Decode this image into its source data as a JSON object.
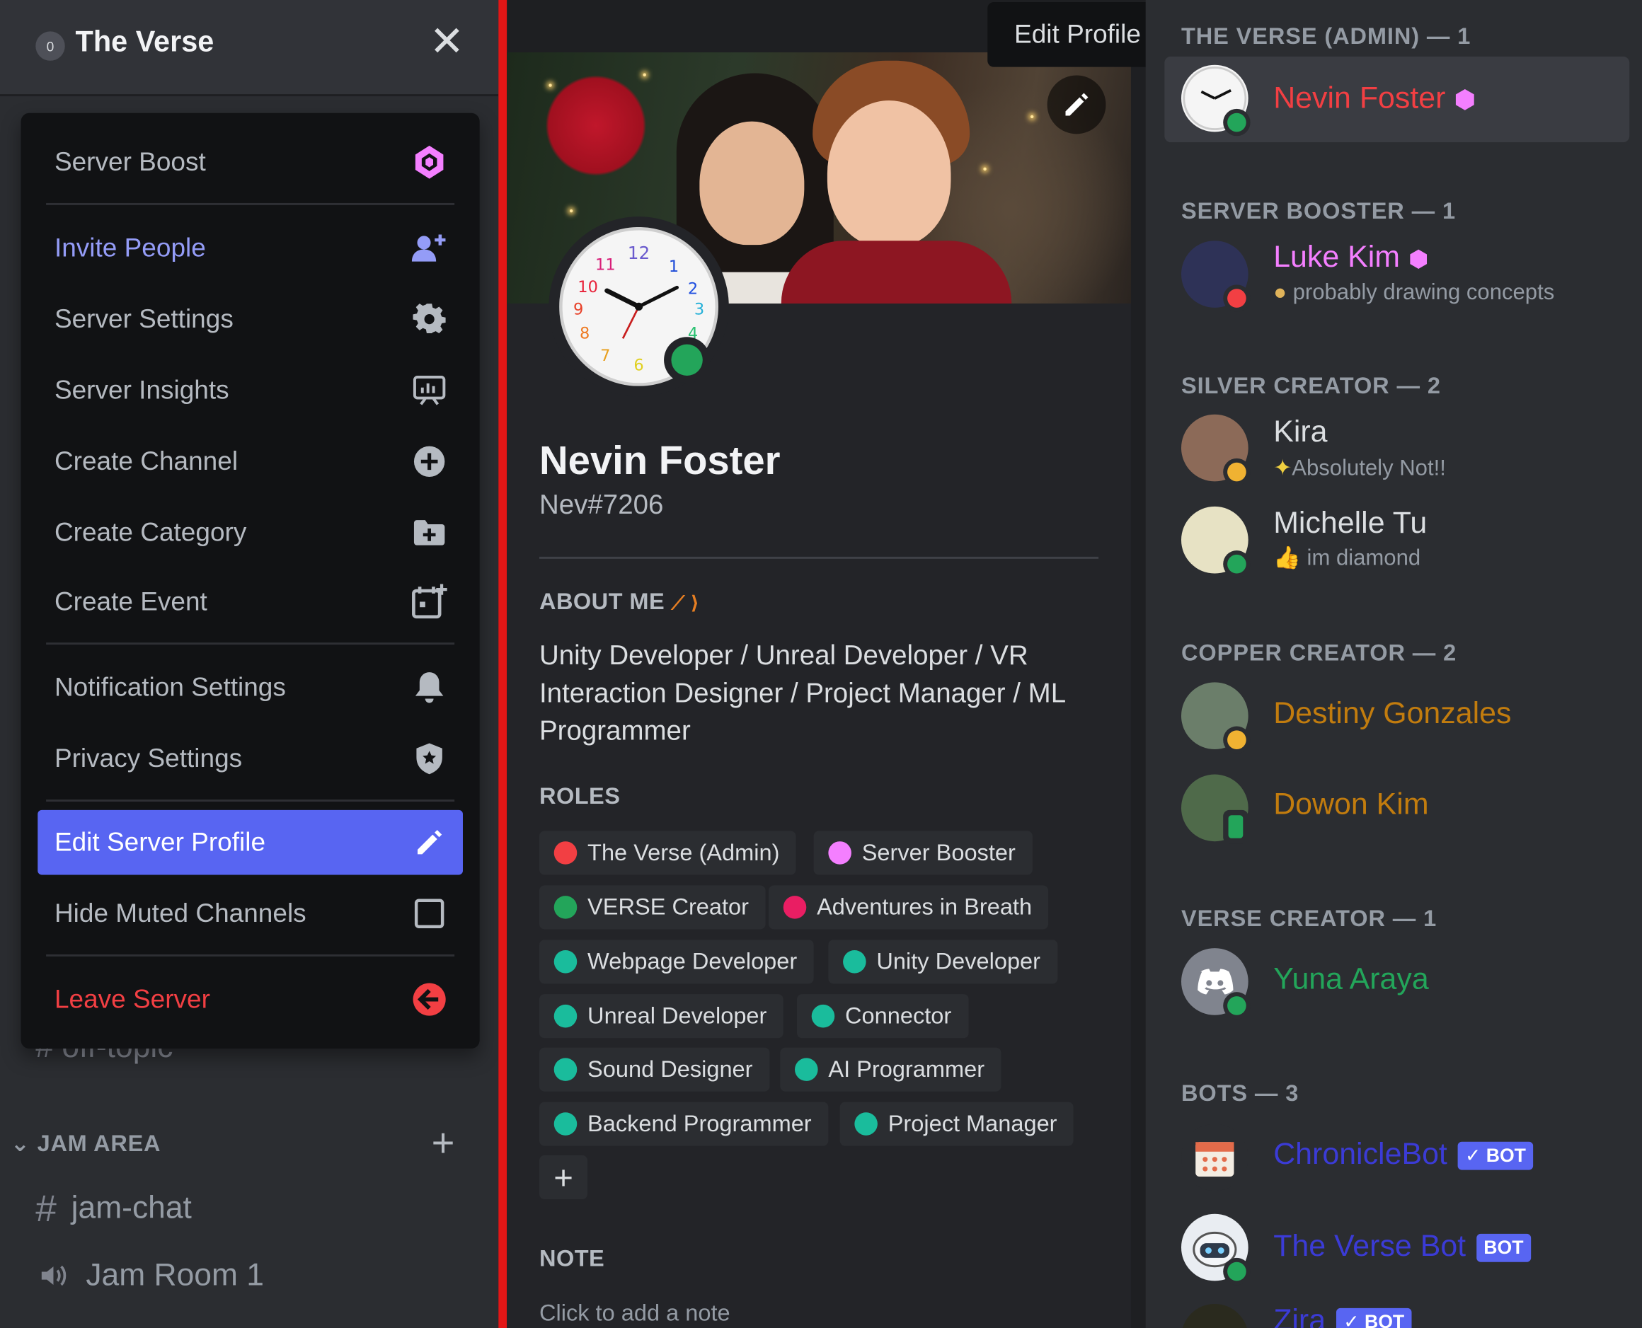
{
  "server": {
    "name": "The Verse",
    "close_glyph": "✕"
  },
  "menu": {
    "items": [
      {
        "label": "Server Boost",
        "icon": "boost-gem-icon"
      },
      {
        "label": "Invite People",
        "icon": "invite-person-icon"
      },
      {
        "label": "Server Settings",
        "icon": "gear-icon"
      },
      {
        "label": "Server Insights",
        "icon": "insights-chart-icon"
      },
      {
        "label": "Create Channel",
        "icon": "plus-circle-icon"
      },
      {
        "label": "Create Category",
        "icon": "folder-plus-icon"
      },
      {
        "label": "Create Event",
        "icon": "calendar-plus-icon"
      },
      {
        "label": "Notification Settings",
        "icon": "bell-icon"
      },
      {
        "label": "Privacy Settings",
        "icon": "shield-icon"
      },
      {
        "label": "Edit Server Profile",
        "icon": "pencil-icon"
      },
      {
        "label": "Hide Muted Channels",
        "icon": "checkbox-icon"
      },
      {
        "label": "Leave Server",
        "icon": "leave-arrow-icon"
      }
    ]
  },
  "channels_behind": {
    "off_topic": "off-topic",
    "category": "JAM AREA",
    "text_channel": "jam-chat",
    "voice_channel": "Jam Room 1"
  },
  "tooltip": "Edit Profile",
  "profile": {
    "display_name": "Nevin Foster",
    "tag": "Nev#7206",
    "about_header": "ABOUT ME",
    "about": "Unity Developer / Unreal Developer / VR Interaction Designer / Project Manager / ML Programmer",
    "roles_header": "ROLES",
    "roles": [
      {
        "name": "The Verse (Admin)",
        "color": "#f23f43"
      },
      {
        "name": "Server Booster",
        "color": "#f47fff"
      },
      {
        "name": "VERSE Creator",
        "color": "#23a55a"
      },
      {
        "name": "Adventures in Breath",
        "color": "#e91e63"
      },
      {
        "name": "Webpage Developer",
        "color": "#1abc9c"
      },
      {
        "name": "Unity Developer",
        "color": "#1abc9c"
      },
      {
        "name": "Unreal Developer",
        "color": "#1abc9c"
      },
      {
        "name": "Connector",
        "color": "#1abc9c"
      },
      {
        "name": "Sound Designer",
        "color": "#1abc9c"
      },
      {
        "name": "AI Programmer",
        "color": "#1abc9c"
      },
      {
        "name": "Backend Programmer",
        "color": "#1abc9c"
      },
      {
        "name": "Project Manager",
        "color": "#1abc9c"
      }
    ],
    "add_role_glyph": "+",
    "note_header": "NOTE",
    "note_placeholder": "Click to add a note",
    "status_color": "#23a55a"
  },
  "member_groups": [
    {
      "label": "THE VERSE (ADMIN) — 1"
    },
    {
      "label": "SERVER BOOSTER — 1"
    },
    {
      "label": "SILVER CREATOR — 2"
    },
    {
      "label": "COPPER CREATOR — 2"
    },
    {
      "label": "VERSE CREATOR — 1"
    },
    {
      "label": "BOTS — 3"
    }
  ],
  "members": [
    {
      "name": "Nevin Foster",
      "color": "#f23f43",
      "activity": "",
      "status": "online"
    },
    {
      "name": "Luke Kim",
      "color": "#f47fff",
      "activity": "probably drawing concepts",
      "status": "dnd"
    },
    {
      "name": "Kira",
      "color": "#dbdee1",
      "activity": "Absolutely Not!!",
      "status": "idle"
    },
    {
      "name": "Michelle Tu",
      "color": "#dbdee1",
      "activity": "im diamond",
      "status": "online"
    },
    {
      "name": "Destiny Gonzales",
      "color": "#c27c0e",
      "activity": "",
      "status": "idle"
    },
    {
      "name": "Dowon Kim",
      "color": "#c27c0e",
      "activity": "",
      "status": "mobile"
    },
    {
      "name": "Yuna Araya",
      "color": "#23a55a",
      "activity": "",
      "status": "online"
    },
    {
      "name": "ChronicleBot",
      "color": "#3b3bd6",
      "activity": "",
      "status": "none",
      "bot": "✓ BOT"
    },
    {
      "name": "The Verse Bot",
      "color": "#3b3bd6",
      "activity": "",
      "status": "online",
      "bot": "BOT"
    },
    {
      "name": "Zira",
      "color": "#3b3bd6",
      "activity": "",
      "status": "none",
      "bot": "✓ BOT"
    }
  ]
}
